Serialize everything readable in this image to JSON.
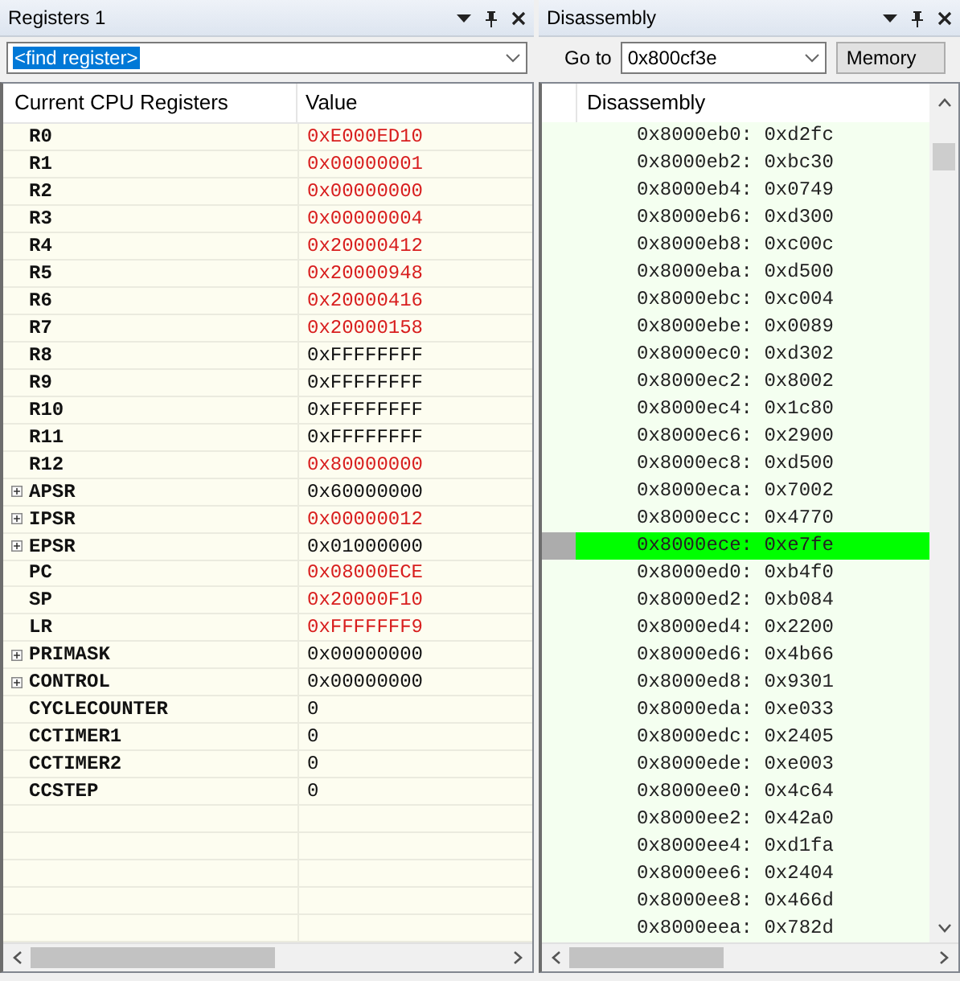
{
  "registers_panel": {
    "title": "Registers 1",
    "find_field": {
      "value": "<find register>"
    },
    "columns": [
      "Current CPU Registers",
      "Value"
    ],
    "rows": [
      {
        "name": "R0",
        "value": "0xE000ED10",
        "changed": true,
        "expandable": false
      },
      {
        "name": "R1",
        "value": "0x00000001",
        "changed": true,
        "expandable": false
      },
      {
        "name": "R2",
        "value": "0x00000000",
        "changed": true,
        "expandable": false
      },
      {
        "name": "R3",
        "value": "0x00000004",
        "changed": true,
        "expandable": false
      },
      {
        "name": "R4",
        "value": "0x20000412",
        "changed": true,
        "expandable": false
      },
      {
        "name": "R5",
        "value": "0x20000948",
        "changed": true,
        "expandable": false
      },
      {
        "name": "R6",
        "value": "0x20000416",
        "changed": true,
        "expandable": false
      },
      {
        "name": "R7",
        "value": "0x20000158",
        "changed": true,
        "expandable": false
      },
      {
        "name": "R8",
        "value": "0xFFFFFFFF",
        "changed": false,
        "expandable": false
      },
      {
        "name": "R9",
        "value": "0xFFFFFFFF",
        "changed": false,
        "expandable": false
      },
      {
        "name": "R10",
        "value": "0xFFFFFFFF",
        "changed": false,
        "expandable": false
      },
      {
        "name": "R11",
        "value": "0xFFFFFFFF",
        "changed": false,
        "expandable": false
      },
      {
        "name": "R12",
        "value": "0x80000000",
        "changed": true,
        "expandable": false
      },
      {
        "name": "APSR",
        "value": "0x60000000",
        "changed": false,
        "expandable": true
      },
      {
        "name": "IPSR",
        "value": "0x00000012",
        "changed": true,
        "expandable": true
      },
      {
        "name": "EPSR",
        "value": "0x01000000",
        "changed": false,
        "expandable": true
      },
      {
        "name": "PC",
        "value": "0x08000ECE",
        "changed": true,
        "expandable": false
      },
      {
        "name": "SP",
        "value": "0x20000F10",
        "changed": true,
        "expandable": false
      },
      {
        "name": "LR",
        "value": "0xFFFFFFF9",
        "changed": true,
        "expandable": false
      },
      {
        "name": "PRIMASK",
        "value": "0x00000000",
        "changed": false,
        "expandable": true
      },
      {
        "name": "CONTROL",
        "value": "0x00000000",
        "changed": false,
        "expandable": true
      },
      {
        "name": "CYCLECOUNTER",
        "value": "0",
        "changed": false,
        "expandable": false
      },
      {
        "name": "CCTIMER1",
        "value": "0",
        "changed": false,
        "expandable": false
      },
      {
        "name": "CCTIMER2",
        "value": "0",
        "changed": false,
        "expandable": false
      },
      {
        "name": "CCSTEP",
        "value": "0",
        "changed": false,
        "expandable": false
      }
    ]
  },
  "disassembly_panel": {
    "title": "Disassembly",
    "goto_label": "Go to",
    "goto_field": {
      "value": "0x800cf3e"
    },
    "memory_button": "Memory",
    "column": "Disassembly",
    "lines": [
      {
        "text": "0x8000eb0: 0xd2fc",
        "current": false
      },
      {
        "text": "0x8000eb2: 0xbc30",
        "current": false
      },
      {
        "text": "0x8000eb4: 0x0749",
        "current": false
      },
      {
        "text": "0x8000eb6: 0xd300",
        "current": false
      },
      {
        "text": "0x8000eb8: 0xc00c",
        "current": false
      },
      {
        "text": "0x8000eba: 0xd500",
        "current": false
      },
      {
        "text": "0x8000ebc: 0xc004",
        "current": false
      },
      {
        "text": "0x8000ebe: 0x0089",
        "current": false
      },
      {
        "text": "0x8000ec0: 0xd302",
        "current": false
      },
      {
        "text": "0x8000ec2: 0x8002",
        "current": false
      },
      {
        "text": "0x8000ec4: 0x1c80",
        "current": false
      },
      {
        "text": "0x8000ec6: 0x2900",
        "current": false
      },
      {
        "text": "0x8000ec8: 0xd500",
        "current": false
      },
      {
        "text": "0x8000eca: 0x7002",
        "current": false
      },
      {
        "text": "0x8000ecc: 0x4770",
        "current": false
      },
      {
        "text": "0x8000ece: 0xe7fe",
        "current": true
      },
      {
        "text": "0x8000ed0: 0xb4f0",
        "current": false
      },
      {
        "text": "0x8000ed2: 0xb084",
        "current": false
      },
      {
        "text": "0x8000ed4: 0x2200",
        "current": false
      },
      {
        "text": "0x8000ed6: 0x4b66",
        "current": false
      },
      {
        "text": "0x8000ed8: 0x9301",
        "current": false
      },
      {
        "text": "0x8000eda: 0xe033",
        "current": false
      },
      {
        "text": "0x8000edc: 0x2405",
        "current": false
      },
      {
        "text": "0x8000ede: 0xe003",
        "current": false
      },
      {
        "text": "0x8000ee0: 0x4c64",
        "current": false
      },
      {
        "text": "0x8000ee2: 0x42a0",
        "current": false
      },
      {
        "text": "0x8000ee4: 0xd1fa",
        "current": false
      },
      {
        "text": "0x8000ee6: 0x2404",
        "current": false
      },
      {
        "text": "0x8000ee8: 0x466d",
        "current": false
      },
      {
        "text": "0x8000eea: 0x782d",
        "current": false
      }
    ]
  }
}
